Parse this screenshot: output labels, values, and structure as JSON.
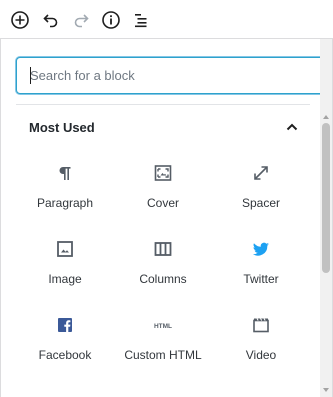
{
  "toolbar": {
    "icons": [
      "add-block-icon",
      "undo-icon",
      "redo-icon",
      "info-icon",
      "list-view-icon"
    ]
  },
  "inserter": {
    "search": {
      "value": "",
      "placeholder": "Search for a block"
    },
    "panel": {
      "title": "Most Used",
      "expanded": true,
      "blocks": [
        {
          "label": "Paragraph",
          "icon": "paragraph-icon"
        },
        {
          "label": "Cover",
          "icon": "cover-icon"
        },
        {
          "label": "Spacer",
          "icon": "spacer-icon"
        },
        {
          "label": "Image",
          "icon": "image-icon"
        },
        {
          "label": "Columns",
          "icon": "columns-icon"
        },
        {
          "label": "Twitter",
          "icon": "twitter-icon"
        },
        {
          "label": "Facebook",
          "icon": "facebook-icon"
        },
        {
          "label": "Custom HTML",
          "icon": "html-icon",
          "icon_text": "HTML"
        },
        {
          "label": "Video",
          "icon": "video-icon"
        }
      ]
    }
  },
  "colors": {
    "accent": "#2ea2cc",
    "twitter": "#1da1f2",
    "facebook": "#3b5998",
    "icon": "#555d66",
    "text": "#32373c"
  }
}
